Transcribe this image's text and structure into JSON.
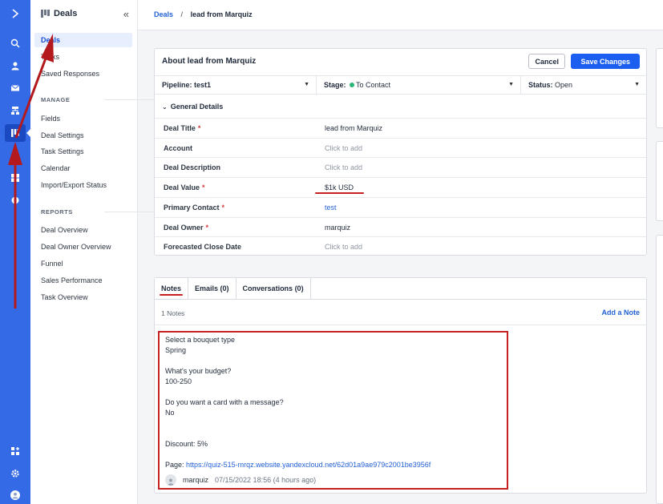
{
  "rail": {
    "icons": [
      "logo-chevron-icon",
      "search-icon",
      "contacts-icon",
      "email-icon",
      "automation-icon",
      "deals-icon",
      "reports-icon",
      "settings-icon",
      "apps-icon",
      "gear-icon",
      "user-avatar-icon"
    ]
  },
  "sidebar": {
    "title": "Deals",
    "items_top": [
      {
        "label": "Deals",
        "active": true
      },
      {
        "label": "Tasks"
      },
      {
        "label": "Saved Responses"
      }
    ],
    "manage_heading": "MANAGE",
    "manage_items": [
      "Fields",
      "Deal Settings",
      "Task Settings",
      "Calendar",
      "Import/Export Status"
    ],
    "reports_heading": "REPORTS",
    "report_items": [
      "Deal Overview",
      "Deal Owner Overview",
      "Funnel",
      "Sales Performance",
      "Task Overview"
    ]
  },
  "breadcrumb": {
    "root": "Deals",
    "separator": "/",
    "current": "lead from Marquiz"
  },
  "deal": {
    "title": "About lead from Marquiz",
    "cancel_label": "Cancel",
    "save_label": "Save Changes",
    "pipeline_label": "Pipeline:",
    "pipeline_value": "test1",
    "stage_label": "Stage:",
    "stage_value": "To Contact",
    "stage_color": "#2bb673",
    "status_label": "Status:",
    "status_value": "Open",
    "section_title": "General Details",
    "fields": [
      {
        "label": "Deal Title",
        "required": true,
        "value": "lead from Marquiz",
        "kind": "text"
      },
      {
        "label": "Account",
        "required": false,
        "value": "Click to add",
        "kind": "placeholder"
      },
      {
        "label": "Deal Description",
        "required": false,
        "value": "Click to add",
        "kind": "placeholder"
      },
      {
        "label": "Deal Value",
        "required": true,
        "value": "$1k USD",
        "kind": "text"
      },
      {
        "label": "Primary Contact",
        "required": true,
        "value": "test",
        "kind": "link"
      },
      {
        "label": "Deal Owner",
        "required": true,
        "value": "marquiz",
        "kind": "text"
      },
      {
        "label": "Forecasted Close Date",
        "required": false,
        "value": "Click to add",
        "kind": "placeholder"
      }
    ]
  },
  "notes": {
    "tabs": [
      "Notes",
      "Emails (0)",
      "Conversations (0)"
    ],
    "count_label": "1 Notes",
    "add_label": "Add a Note",
    "note_lines": [
      "Select a bouquet type",
      "Spring",
      "What's your budget?",
      "100-250",
      "Do you want a card with a message?",
      "No",
      "Discount: 5%"
    ],
    "page_label": "Page:",
    "page_url": "https://quiz-515-mrqz.website.yandexcloud.net/62d01a9ae979c2001be3956f",
    "author": "marquiz",
    "timestamp": "07/15/2022 18:56 (4 hours ago)"
  },
  "accent_color": "#1c5ff0",
  "annotation_color": "#c62020"
}
